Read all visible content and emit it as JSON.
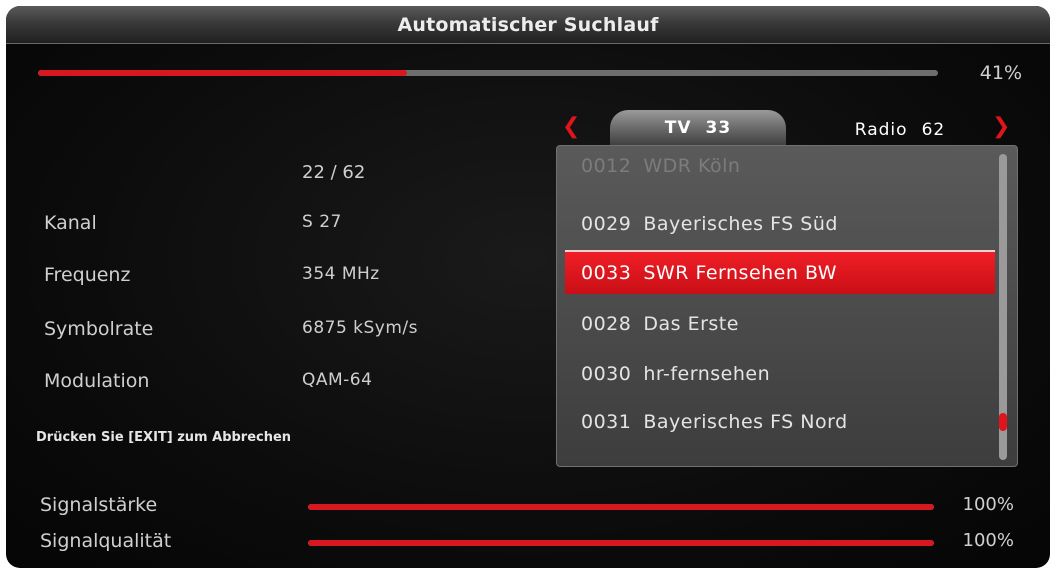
{
  "title": "Automatischer Suchlauf",
  "progress": {
    "value": 41,
    "label": "41%"
  },
  "counter": "22 / 62",
  "info": [
    {
      "label": "Kanal",
      "value": "S 27"
    },
    {
      "label": "Frequenz",
      "value": "354 MHz"
    },
    {
      "label": "Symbolrate",
      "value": "6875 kSym/s"
    },
    {
      "label": "Modulation",
      "value": "QAM-64"
    }
  ],
  "hint": "Drücken Sie [EXIT] zum Abbrechen",
  "tabs": {
    "tv": {
      "label": "TV",
      "count": "33"
    },
    "radio": {
      "label": "Radio",
      "count": "62"
    }
  },
  "channels": [
    {
      "num": "0012",
      "name": "WDR Köln"
    },
    {
      "num": "0029",
      "name": "Bayerisches FS Süd"
    },
    {
      "num": "0033",
      "name": "SWR Fernsehen BW"
    },
    {
      "num": "0028",
      "name": "Das Erste"
    },
    {
      "num": "0030",
      "name": "hr-fernsehen"
    },
    {
      "num": "0031",
      "name": "Bayerisches FS Nord"
    }
  ],
  "selected_channel_index": 2,
  "scroll_position": 0.9,
  "signal": [
    {
      "label": "Signalstärke",
      "value": 100,
      "pct_label": "100%"
    },
    {
      "label": "Signalqualität",
      "value": 100,
      "pct_label": "100%"
    }
  ],
  "icons": {
    "prev": "chevron-left-icon",
    "next": "chevron-right-icon"
  },
  "colors": {
    "accent": "#d81820",
    "track": "#6e6e6e",
    "selected": "#e8141c"
  }
}
